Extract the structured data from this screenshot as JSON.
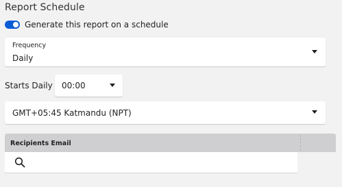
{
  "report_schedule": {
    "title": "Report Schedule",
    "toggle": {
      "label": "Generate this report on a schedule",
      "checked": true,
      "accent_color": "#0a5bd6"
    },
    "frequency": {
      "label": "Frequency",
      "value": "Daily",
      "icon": "caret-down-icon"
    },
    "starts": {
      "label": "Starts Daily",
      "time_value": "00:00",
      "icon": "caret-down-icon"
    },
    "timezone": {
      "value": "GMT+05:45 Katmandu (NPT)",
      "icon": "caret-down-icon"
    },
    "recipients": {
      "header": "Recipients Email",
      "search": {
        "value": "",
        "placeholder": "",
        "icon": "search-icon"
      }
    }
  }
}
